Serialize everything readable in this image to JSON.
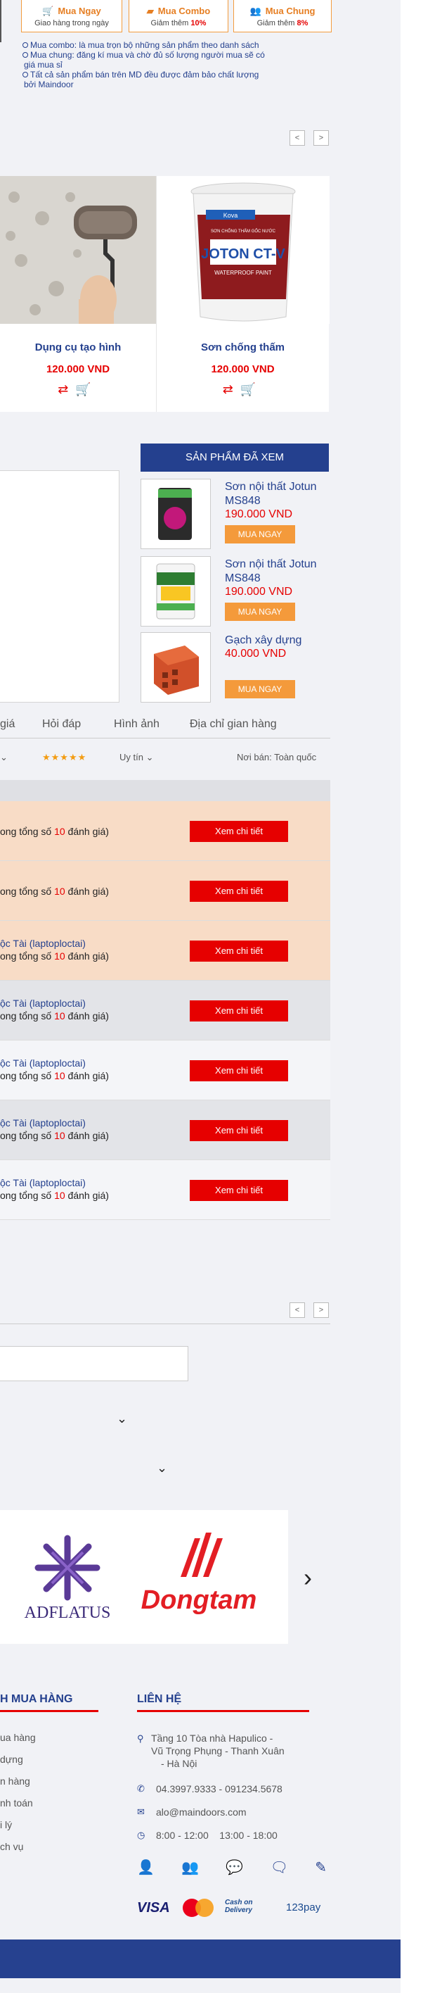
{
  "buy_options": [
    {
      "title": "Mua Ngay",
      "subtitle": "Giao hàng trong ngày",
      "discount": ""
    },
    {
      "title": "Mua Combo",
      "subtitle": "Giảm thêm",
      "discount": "10%"
    },
    {
      "title": "Mua Chung",
      "subtitle": "Giảm thêm",
      "discount": "8%"
    }
  ],
  "notes": [
    "Mua combo: là mua trọn bộ những sản phẩm theo danh sách",
    "Mua chung: đăng kí mua và chờ đủ số lượng người mua sẽ có",
    "giá mua sỉ",
    "Tất cả sản phẩm bán trên MD đều được đảm bảo chất lượng",
    "bởi Maindoor"
  ],
  "products": [
    {
      "name": "Dụng cụ tạo hình",
      "price": "120.000 VND"
    },
    {
      "name": "Sơn chống thấm",
      "price": "120.000 VND"
    }
  ],
  "product_image_text": {
    "brand": "Kova",
    "label": "SƠN CHỐNG THẤM GỐC NƯỚC",
    "product": "JOTON CT-V",
    "sub": "WATERPROOF PAINT"
  },
  "viewed": {
    "title": "SẢN PHẨM ĐÃ XEM",
    "items": [
      {
        "name": "Sơn nội thất Jotun MS848",
        "price": "190.000 VND",
        "buy": "MUA NGAY"
      },
      {
        "name": "Sơn nội thất Jotun MS848",
        "price": "190.000 VND",
        "buy": "MUA NGAY"
      },
      {
        "name": "Gạch xây dựng",
        "price": "40.000 VND",
        "buy": "MUA NGAY"
      }
    ]
  },
  "tabs": [
    "giá",
    "Hỏi đáp",
    "Hình ảnh",
    "Địa chỉ gian hàng"
  ],
  "filters": {
    "sort": "Uy tín",
    "location": "Nơi bán: Toàn quốc",
    "stars": "★★★★★"
  },
  "reviews": [
    {
      "author": "",
      "line2_prefix": "ong tổng số",
      "count": "10",
      "line2_suffix": "đánh giá)",
      "button": "Xem chi tiết",
      "bg": "#f8dcc6"
    },
    {
      "author": "",
      "line2_prefix": "ong tổng số",
      "count": "10",
      "line2_suffix": "đánh giá)",
      "button": "Xem chi tiết",
      "bg": "#f8dcc6"
    },
    {
      "author": "ộc Tài (laptoploctai)",
      "line2_prefix": "ong tổng số",
      "count": "10",
      "line2_suffix": "đánh giá)",
      "button": "Xem chi tiết",
      "bg": "#f8dcc6"
    },
    {
      "author": "ộc Tài (laptoploctai)",
      "line2_prefix": "ong tổng số",
      "count": "10",
      "line2_suffix": "đánh giá)",
      "button": "Xem chi tiết",
      "bg": "#e3e4e8"
    },
    {
      "author": "ộc Tài (laptoploctai)",
      "line2_prefix": "ong tổng số",
      "count": "10",
      "line2_suffix": "đánh giá)",
      "button": "Xem chi tiết",
      "bg": "#f4f5f8"
    },
    {
      "author": "ộc Tài (laptoploctai)",
      "line2_prefix": "ong tổng số",
      "count": "10",
      "line2_suffix": "đánh giá)",
      "button": "Xem chi tiết",
      "bg": "#e3e4e8"
    },
    {
      "author": "ộc Tài (laptoploctai)",
      "line2_prefix": "ong tổng số",
      "count": "10",
      "line2_suffix": "đánh giá)",
      "button": "Xem chi tiết",
      "bg": "#f4f5f8"
    }
  ],
  "brands": [
    {
      "name": "ADFLATUS",
      "color": "#3b2a78"
    },
    {
      "name": "Dongtam",
      "color": "#e31e24"
    }
  ],
  "footer": {
    "col1_title": "H MUA HÀNG",
    "col1_links": [
      "ua hàng",
      "dựng",
      "n hàng",
      "nh toán",
      "i lý",
      "ch vụ"
    ],
    "col2_title": "LIÊN HỆ",
    "address": [
      "Tầng 10 Tòa nhà Hapulico -",
      "Vũ Trọng Phụng - Thanh Xuân",
      "- Hà Nội"
    ],
    "phone": "04.3997.9333 - 091234.5678",
    "email": "alo@maindoors.com",
    "hours": "8:00 - 12:00    13:00 - 18:00",
    "payments": [
      "VISA",
      "MasterCard",
      "Cash on Delivery",
      "123pay"
    ],
    "payment_sub": "Cash on\nDelivery"
  },
  "colors": {
    "brand_blue": "#24408e",
    "accent_red": "#e60000",
    "accent_orange": "#f49a3b",
    "footer_bar": "#26418f"
  }
}
